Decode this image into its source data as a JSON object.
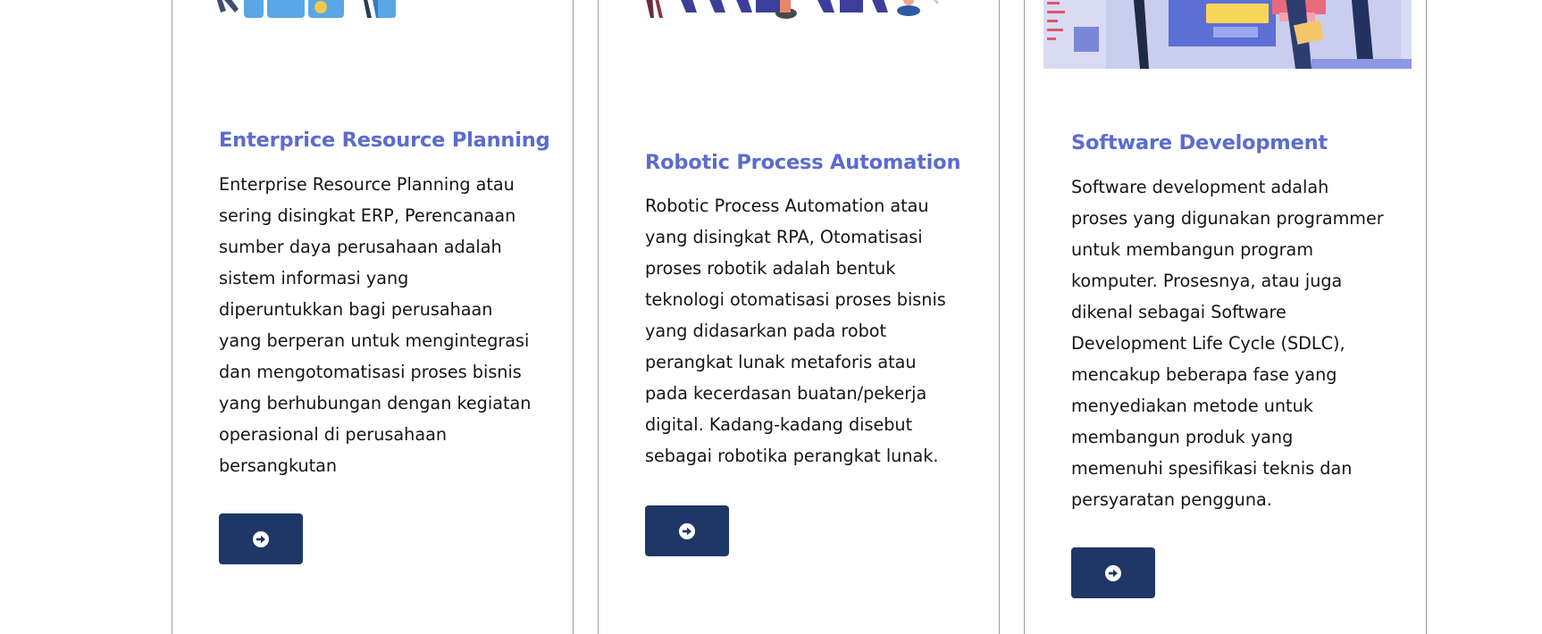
{
  "cards": [
    {
      "title": "Enterprice Resource Planning",
      "description": "Enterprise Resource Planning atau sering disingkat ERP, Perencanaan sumber daya perusahaan adalah sistem informasi yang diperuntukkan bagi perusahaan yang berperan untuk mengintegrasi dan mengotomatisasi proses bisnis yang berhubungan dengan kegiatan operasional di perusahaan bersangkutan",
      "button_icon": "arrow-circle-right-icon"
    },
    {
      "title": "Robotic Process Automation",
      "description": "Robotic Process Automation atau yang disingkat RPA, Otomatisasi proses robotik adalah bentuk teknologi otomatisasi proses bisnis yang didasarkan pada robot perangkat lunak metaforis atau pada kecerdasan buatan/pekerja digital. Kadang-kadang disebut sebagai robotika perangkat lunak.",
      "button_icon": "arrow-circle-right-icon"
    },
    {
      "title": "Software Development",
      "description": "Software development adalah proses yang digunakan programmer untuk membangun program komputer. Prosesnya, atau juga dikenal sebagai Software Development Life Cycle (SDLC), mencakup beberapa fase yang menyediakan metode untuk membangun produk yang memenuhi spesifikasi teknis dan persyaratan pengguna.",
      "button_icon": "arrow-circle-right-icon"
    }
  ],
  "colors": {
    "title": "#5b6bd0",
    "text": "#151515",
    "button_bg": "#1e3766",
    "card_border": "#9c9c9c"
  }
}
